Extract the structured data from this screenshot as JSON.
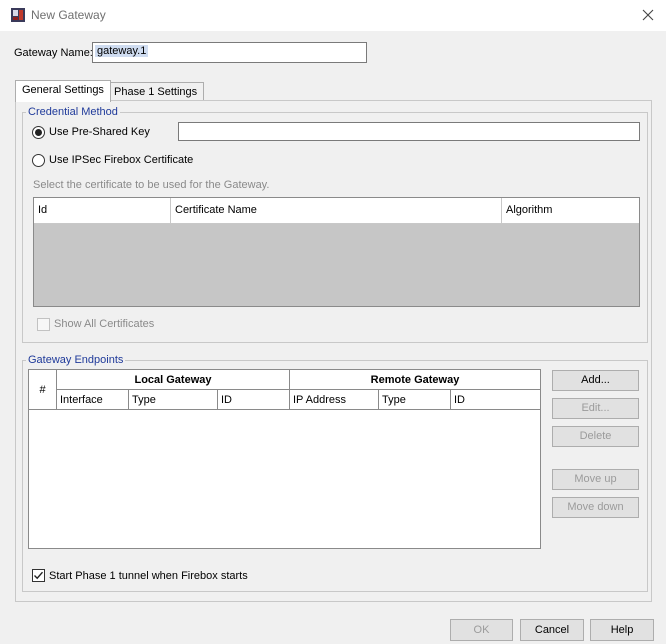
{
  "window": {
    "title": "New Gateway",
    "app_icon": "firebox-app-icon",
    "close_icon": "close-icon"
  },
  "gateway_name": {
    "label": "Gateway Name:",
    "value": "gateway.1"
  },
  "tabs": [
    {
      "label": "General Settings",
      "active": true
    },
    {
      "label": "Phase 1 Settings",
      "active": false
    }
  ],
  "credential_method": {
    "legend": "Credential Method",
    "pre_shared_key": {
      "label": "Use Pre-Shared Key",
      "selected": true,
      "value": ""
    },
    "certificate": {
      "label": "Use IPSec Firebox Certificate",
      "selected": false
    },
    "hint": "Select the certificate to be used for the Gateway.",
    "cert_table_columns": [
      "Id",
      "Certificate Name",
      "Algorithm"
    ],
    "cert_table_rows": [],
    "show_all_certificates": {
      "label": "Show All Certificates",
      "checked": false,
      "enabled": false
    }
  },
  "gateway_endpoints": {
    "legend": "Gateway Endpoints",
    "columns": {
      "index": "#",
      "local_group": "Local Gateway",
      "remote_group": "Remote Gateway",
      "local": [
        "Interface",
        "Type",
        "ID"
      ],
      "remote": [
        "IP Address",
        "Type",
        "ID"
      ]
    },
    "rows": [],
    "buttons": {
      "add": "Add...",
      "edit": "Edit...",
      "delete": "Delete",
      "move_up": "Move up",
      "move_down": "Move down"
    }
  },
  "start_phase1": {
    "label": "Start Phase 1 tunnel when Firebox starts",
    "checked": true
  },
  "footer": {
    "ok": "OK",
    "cancel": "Cancel",
    "help": "Help"
  }
}
